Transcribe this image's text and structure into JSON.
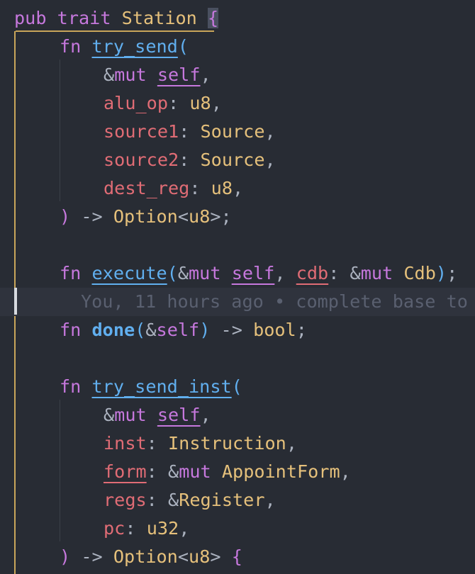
{
  "code": {
    "l1": {
      "pub": "pub",
      "trait": "trait",
      "name": "Station",
      "open": "{"
    },
    "try_send": {
      "fn": "fn",
      "name": "try_send",
      "open": "(",
      "p1_amp": "&",
      "p1_mut": "mut",
      "p1_self": "self",
      "p1_comma": ",",
      "p2_name": "alu_op",
      "p2_colon": ":",
      "p2_type": "u8",
      "p2_comma": ",",
      "p3_name": "source1",
      "p3_colon": ":",
      "p3_type": "Source",
      "p3_comma": ",",
      "p4_name": "source2",
      "p4_colon": ":",
      "p4_type": "Source",
      "p4_comma": ",",
      "p5_name": "dest_reg",
      "p5_colon": ":",
      "p5_type": "u8",
      "p5_comma": ",",
      "close": ")",
      "arrow": "->",
      "ret_type": "Option",
      "ret_lt": "<",
      "ret_inner": "u8",
      "ret_gt": ">",
      "semi": ";"
    },
    "execute": {
      "fn": "fn",
      "name": "execute",
      "open": "(",
      "amp": "&",
      "mut": "mut",
      "self": "self",
      "comma": ",",
      "cdb": "cdb",
      "colon": ":",
      "amp2": "&",
      "mut2": "mut",
      "type": "Cdb",
      "close": ")",
      "semi": ";"
    },
    "blame": "You, 11 hours ago • complete base to",
    "done": {
      "fn": "fn",
      "name": "done",
      "open": "(",
      "amp": "&",
      "self": "self",
      "close": ")",
      "arrow": "->",
      "ret": "bool",
      "semi": ";"
    },
    "try_send_inst": {
      "fn": "fn",
      "name": "try_send_inst",
      "open": "(",
      "p1_amp": "&",
      "p1_mut": "mut",
      "p1_self": "self",
      "p1_comma": ",",
      "p2_name": "inst",
      "p2_colon": ":",
      "p2_type": "Instruction",
      "p2_comma": ",",
      "p3_name": "form",
      "p3_colon": ":",
      "p3_amp": "&",
      "p3_mut": "mut",
      "p3_type": "AppointForm",
      "p3_comma": ",",
      "p4_name": "regs",
      "p4_colon": ":",
      "p4_amp": "&",
      "p4_type": "Register",
      "p4_comma": ",",
      "p5_name": "pc",
      "p5_colon": ":",
      "p5_type": "u32",
      "p5_comma": ",",
      "close": ")",
      "arrow": "->",
      "ret_type": "Option",
      "ret_lt": "<",
      "ret_inner": "u8",
      "ret_gt": ">",
      "body_open": "{"
    }
  },
  "colors": {
    "background": "#282c34",
    "keyword": "#c678dd",
    "type": "#e5c07b",
    "function": "#61afef",
    "parameter": "#e06c75",
    "punctuation": "#abb2bf",
    "blame": "#5a6070"
  }
}
